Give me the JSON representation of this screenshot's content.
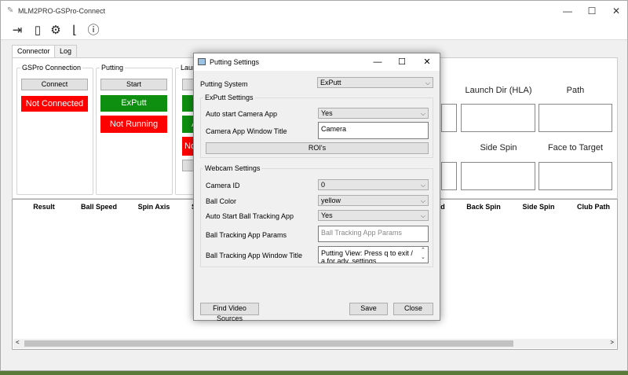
{
  "window": {
    "title": "MLM2PRO-GSPro-Connect",
    "min": "—",
    "max": "☐",
    "close": "✕"
  },
  "toolbar": {
    "icons": [
      "exit-icon",
      "phone-icon",
      "gear-icon",
      "club-icon",
      "info-icon"
    ]
  },
  "tabs": [
    "Connector",
    "Log"
  ],
  "groups": {
    "gspro": {
      "label": "GSPro Connection",
      "button": "Connect",
      "status": "Not Connected"
    },
    "putting": {
      "label": "Putting",
      "button": "Start",
      "system": "ExPutt",
      "status": "Not Running"
    },
    "launch": {
      "label": "Laun",
      "green_text": "A",
      "red_text": "No"
    }
  },
  "metrics": {
    "row1": [
      "Launch Dir (HLA)",
      "Path"
    ],
    "row2": [
      "Side Spin",
      "Face to Target"
    ]
  },
  "table": {
    "left_headers": [
      "Result",
      "Ball Speed",
      "Spin Axis",
      "S"
    ],
    "right_headers": [
      "d",
      "Back Spin",
      "Side Spin",
      "Club Path"
    ],
    "scroll_left": "<",
    "scroll_right": ">"
  },
  "dialog": {
    "title": "Putting Settings",
    "min": "—",
    "max": "☐",
    "close": "✕",
    "putting_system_label": "Putting System",
    "putting_system_value": "ExPutt",
    "exputt_section": "ExPutt Settings",
    "auto_start_label": "Auto start Camera App",
    "auto_start_value": "Yes",
    "window_title_label": "Camera App Window Title",
    "window_title_value": "Camera",
    "rois_button": "ROI's",
    "webcam_section": "Webcam Settings",
    "camera_id_label": "Camera ID",
    "camera_id_value": "0",
    "ball_color_label": "Ball Color",
    "ball_color_value": "yellow",
    "auto_tracking_label": "Auto Start Ball Tracking App",
    "auto_tracking_value": "Yes",
    "params_label": "Ball Tracking App Params",
    "params_placeholder": "Ball Tracking App Params",
    "tracking_title_label": "Ball Tracking App Window Title",
    "tracking_title_value": "Putting View: Press q to exit / a for adv. settings",
    "find_button": "Find Video Sources",
    "save_button": "Save",
    "close_button": "Close"
  }
}
